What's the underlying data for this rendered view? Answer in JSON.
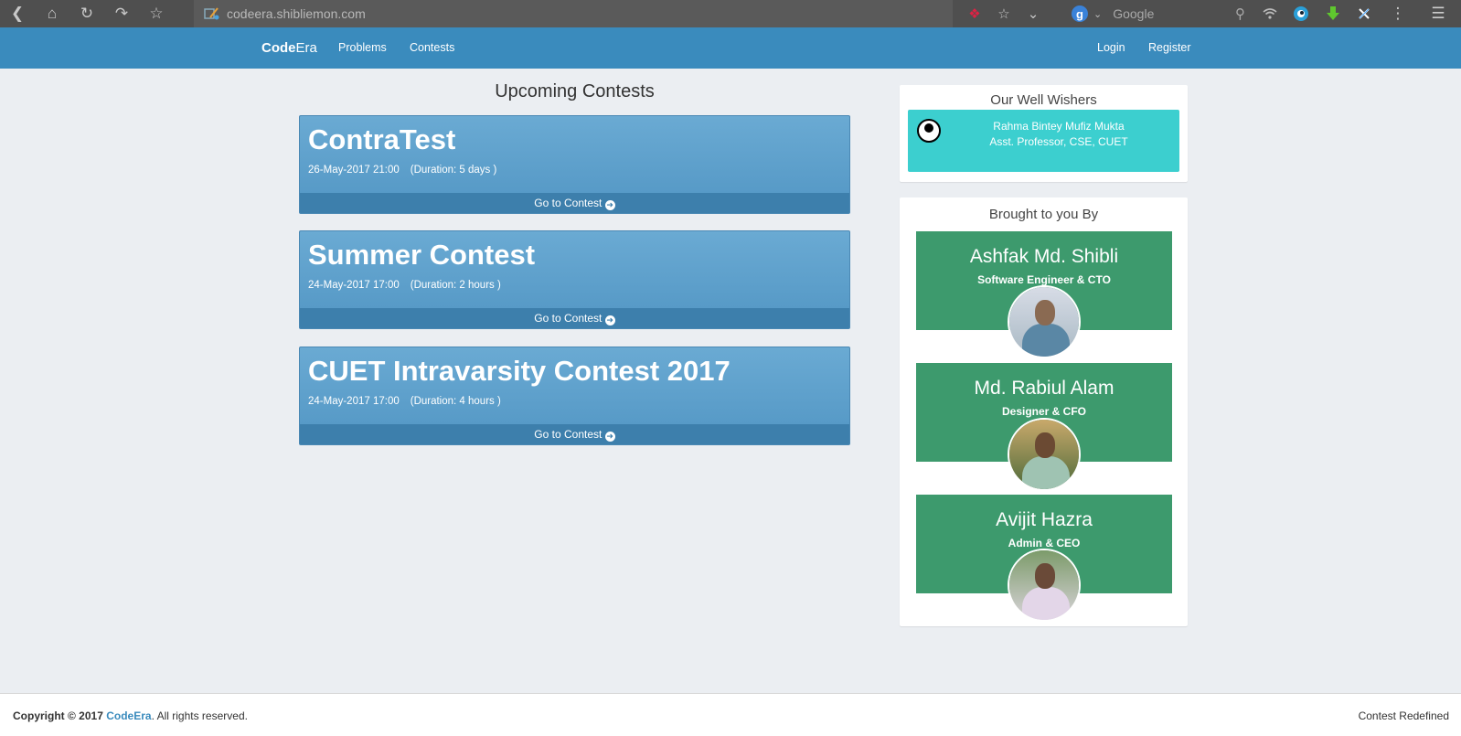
{
  "browser": {
    "url": "codeera.shibliemon.com",
    "search_placeholder": "Google",
    "search_engine_letter": "g"
  },
  "navbar": {
    "brand_bold": "Code",
    "brand_rest": "Era",
    "links": [
      "Problems",
      "Contests"
    ],
    "login": "Login",
    "register": "Register"
  },
  "main": {
    "title": "Upcoming Contests",
    "contests": [
      {
        "name": "ContraTest",
        "date": "26-May-2017 21:00",
        "duration": "(Duration: 5 days )",
        "action": "Go to Contest"
      },
      {
        "name": "Summer Contest",
        "date": "24-May-2017 17:00",
        "duration": "(Duration: 2 hours )",
        "action": "Go to Contest"
      },
      {
        "name": "CUET Intravarsity Contest 2017",
        "date": "24-May-2017 17:00",
        "duration": "(Duration: 4 hours )",
        "action": "Go to Contest"
      }
    ]
  },
  "sidebar": {
    "well_wishers_title": "Our Well Wishers",
    "well_wisher": {
      "name": "Rahma Bintey Mufiz Mukta",
      "role": "Asst. Professor, CSE, CUET"
    },
    "brought_title": "Brought to you By",
    "team": [
      {
        "name": "Ashfak Md. Shibli",
        "role": "Software Engineer & CTO"
      },
      {
        "name": "Md. Rabiul Alam",
        "role": "Designer & CFO"
      },
      {
        "name": "Avijit Hazra",
        "role": "Admin & CEO"
      }
    ]
  },
  "footer": {
    "copyright_prefix": "Copyright © 2017",
    "brand": "CodeEra",
    "suffix": ". All rights reserved.",
    "tagline": "Contest Redefined"
  },
  "colors": {
    "navbar": "#3a8bbd",
    "contest_card": "#5296c4",
    "well_wisher_box": "#3ccfcf",
    "team_card": "#3d9a6d",
    "page_bg": "#ebeef2"
  }
}
